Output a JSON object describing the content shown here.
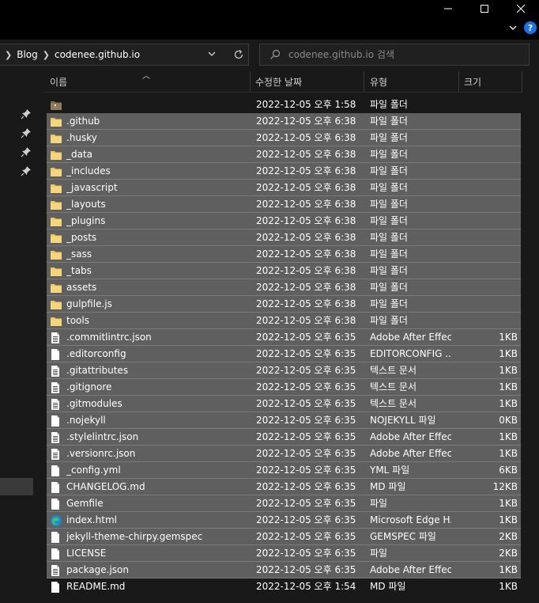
{
  "window": {
    "minimize_icon": "minimize-icon",
    "maximize_icon": "maximize-icon",
    "close_icon": "close-icon",
    "help_label": "?"
  },
  "address": {
    "breadcrumbs": [
      "Blog",
      "codenee.github.io"
    ],
    "search_placeholder": "codenee.github.io 검색"
  },
  "columns": {
    "name": "이름",
    "date": "수정한 날짜",
    "type": "유형",
    "size": "크기"
  },
  "colors": {
    "selection": "#5f5f5f",
    "folder": "#f2c55c",
    "background": "#191919",
    "edge_blue": "#1e88d6"
  },
  "files": [
    {
      "name": "",
      "date": "2022-12-05 오후 1:58",
      "type": "파일 폴더",
      "size": "",
      "icon": "folder-dark",
      "selected": false
    },
    {
      "name": ".github",
      "date": "2022-12-05 오후 6:38",
      "type": "파일 폴더",
      "size": "",
      "icon": "folder",
      "selected": true
    },
    {
      "name": ".husky",
      "date": "2022-12-05 오후 6:38",
      "type": "파일 폴더",
      "size": "",
      "icon": "folder",
      "selected": true
    },
    {
      "name": "_data",
      "date": "2022-12-05 오후 6:38",
      "type": "파일 폴더",
      "size": "",
      "icon": "folder",
      "selected": true
    },
    {
      "name": "_includes",
      "date": "2022-12-05 오후 6:38",
      "type": "파일 폴더",
      "size": "",
      "icon": "folder",
      "selected": true
    },
    {
      "name": "_javascript",
      "date": "2022-12-05 오후 6:38",
      "type": "파일 폴더",
      "size": "",
      "icon": "folder",
      "selected": true
    },
    {
      "name": "_layouts",
      "date": "2022-12-05 오후 6:38",
      "type": "파일 폴더",
      "size": "",
      "icon": "folder",
      "selected": true
    },
    {
      "name": "_plugins",
      "date": "2022-12-05 오후 6:38",
      "type": "파일 폴더",
      "size": "",
      "icon": "folder",
      "selected": true
    },
    {
      "name": "_posts",
      "date": "2022-12-05 오후 6:38",
      "type": "파일 폴더",
      "size": "",
      "icon": "folder",
      "selected": true
    },
    {
      "name": "_sass",
      "date": "2022-12-05 오후 6:38",
      "type": "파일 폴더",
      "size": "",
      "icon": "folder",
      "selected": true
    },
    {
      "name": "_tabs",
      "date": "2022-12-05 오후 6:38",
      "type": "파일 폴더",
      "size": "",
      "icon": "folder",
      "selected": true
    },
    {
      "name": "assets",
      "date": "2022-12-05 오후 6:38",
      "type": "파일 폴더",
      "size": "",
      "icon": "folder",
      "selected": true
    },
    {
      "name": "gulpfile.js",
      "date": "2022-12-05 오후 6:38",
      "type": "파일 폴더",
      "size": "",
      "icon": "folder",
      "selected": true
    },
    {
      "name": "tools",
      "date": "2022-12-05 오후 6:38",
      "type": "파일 폴더",
      "size": "",
      "icon": "folder",
      "selected": true
    },
    {
      "name": ".commitlintrc.json",
      "date": "2022-12-05 오후 6:35",
      "type": "Adobe After Effec...",
      "size": "1KB",
      "icon": "text-file",
      "selected": true
    },
    {
      "name": ".editorconfig",
      "date": "2022-12-05 오후 6:35",
      "type": "EDITORCONFIG ...",
      "size": "1KB",
      "icon": "file",
      "selected": true
    },
    {
      "name": ".gitattributes",
      "date": "2022-12-05 오후 6:35",
      "type": "텍스트 문서",
      "size": "1KB",
      "icon": "text-file",
      "selected": true
    },
    {
      "name": ".gitignore",
      "date": "2022-12-05 오후 6:35",
      "type": "텍스트 문서",
      "size": "1KB",
      "icon": "text-file",
      "selected": true
    },
    {
      "name": ".gitmodules",
      "date": "2022-12-05 오후 6:35",
      "type": "텍스트 문서",
      "size": "1KB",
      "icon": "text-file",
      "selected": true
    },
    {
      "name": ".nojekyll",
      "date": "2022-12-05 오후 6:35",
      "type": "NOJEKYLL 파일",
      "size": "0KB",
      "icon": "file",
      "selected": true
    },
    {
      "name": ".stylelintrc.json",
      "date": "2022-12-05 오후 6:35",
      "type": "Adobe After Effec...",
      "size": "1KB",
      "icon": "text-file",
      "selected": true
    },
    {
      "name": ".versionrc.json",
      "date": "2022-12-05 오후 6:35",
      "type": "Adobe After Effec...",
      "size": "1KB",
      "icon": "text-file",
      "selected": true
    },
    {
      "name": "_config.yml",
      "date": "2022-12-05 오후 6:35",
      "type": "YML 파일",
      "size": "6KB",
      "icon": "file",
      "selected": true
    },
    {
      "name": "CHANGELOG.md",
      "date": "2022-12-05 오후 6:35",
      "type": "MD 파일",
      "size": "12KB",
      "icon": "file",
      "selected": true
    },
    {
      "name": "Gemfile",
      "date": "2022-12-05 오후 6:35",
      "type": "파일",
      "size": "1KB",
      "icon": "file",
      "selected": true
    },
    {
      "name": "index.html",
      "date": "2022-12-05 오후 6:35",
      "type": "Microsoft Edge H...",
      "size": "1KB",
      "icon": "edge",
      "selected": true
    },
    {
      "name": "jekyll-theme-chirpy.gemspec",
      "date": "2022-12-05 오후 6:35",
      "type": "GEMSPEC 파일",
      "size": "2KB",
      "icon": "file",
      "selected": true
    },
    {
      "name": "LICENSE",
      "date": "2022-12-05 오후 6:35",
      "type": "파일",
      "size": "2KB",
      "icon": "file",
      "selected": true
    },
    {
      "name": "package.json",
      "date": "2022-12-05 오후 6:35",
      "type": "Adobe After Effec...",
      "size": "1KB",
      "icon": "text-file",
      "selected": true
    },
    {
      "name": "README.md",
      "date": "2022-12-05 오후 1:54",
      "type": "MD 파일",
      "size": "1KB",
      "icon": "file",
      "selected": false
    }
  ]
}
